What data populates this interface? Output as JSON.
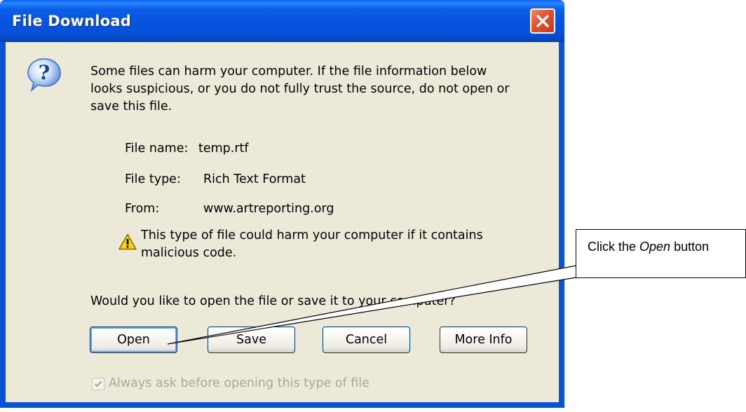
{
  "window": {
    "title": "File Download"
  },
  "message": {
    "lines": [
      "Some files can harm your computer. If the file information below",
      "looks suspicious, or you do not fully trust the source, do not open or",
      "save this file."
    ]
  },
  "file_info": {
    "name_label": "File name:",
    "name_value": "temp.rtf",
    "type_label": "File type:",
    "type_value": "Rich Text Format",
    "from_label": "From:",
    "from_value": "www.artreporting.org"
  },
  "warning": {
    "lines": [
      "This type of file could harm your computer if it contains",
      "malicious code."
    ]
  },
  "question": "Would you like to open the file or save it to your computer?",
  "buttons": {
    "open": "Open",
    "save": "Save",
    "cancel": "Cancel",
    "more_info": "More Info"
  },
  "checkbox": {
    "label": "Always ask before opening this type of file",
    "checked": true,
    "disabled": true
  },
  "callout": {
    "prefix": "Click the ",
    "emphasis": "Open",
    "suffix": " button"
  },
  "icons": {
    "question": "question-icon",
    "warning": "warning-icon",
    "close": "close-icon",
    "check": "check-icon"
  },
  "colors": {
    "titlebar": "#0653df",
    "client": "#ece9d8",
    "close_button": "#e1512f",
    "disabled_text": "#aca899"
  }
}
